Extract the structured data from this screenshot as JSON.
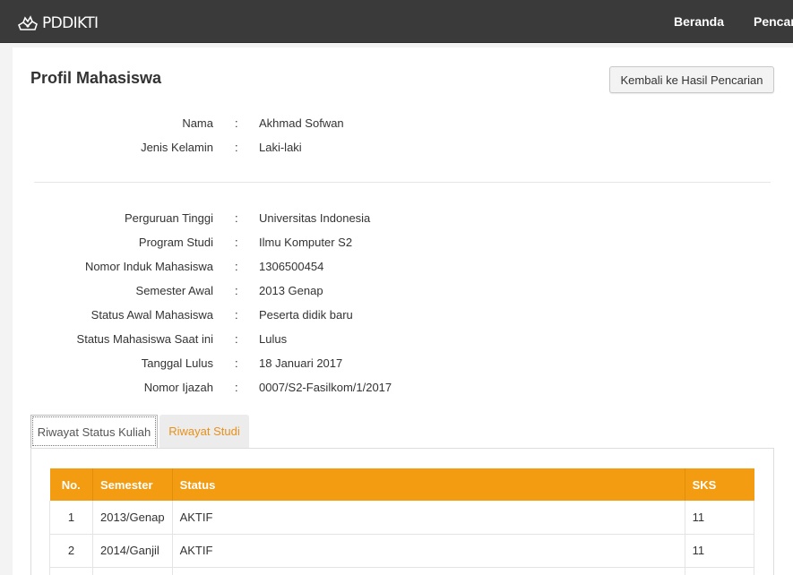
{
  "navbar": {
    "brand": "PDDIKTI",
    "items": [
      "Beranda",
      "Pencarian"
    ]
  },
  "header": {
    "title": "Profil Mahasiswa",
    "back_button": "Kembali ke Hasil Pencarian"
  },
  "profile_basic": [
    {
      "label": "Nama",
      "value": "Akhmad Sofwan"
    },
    {
      "label": "Jenis Kelamin",
      "value": "Laki-laki"
    }
  ],
  "profile_academic": [
    {
      "label": "Perguruan Tinggi",
      "value": "Universitas Indonesia"
    },
    {
      "label": "Program Studi",
      "value": "Ilmu Komputer S2"
    },
    {
      "label": "Nomor Induk Mahasiswa",
      "value": "1306500454"
    },
    {
      "label": "Semester Awal",
      "value": "2013 Genap"
    },
    {
      "label": "Status Awal Mahasiswa",
      "value": "Peserta didik baru"
    },
    {
      "label": "Status Mahasiswa Saat ini",
      "value": "Lulus"
    },
    {
      "label": "Tanggal Lulus",
      "value": "18 Januari 2017"
    },
    {
      "label": "Nomor Ijazah",
      "value": "0007/S2-Fasilkom/1/2017"
    }
  ],
  "separator": ":",
  "tabs": [
    {
      "label": "Riwayat Status Kuliah",
      "active": true
    },
    {
      "label": "Riwayat Studi",
      "active": false
    }
  ],
  "history_table": {
    "headers": [
      "No.",
      "Semester",
      "Status",
      "SKS"
    ],
    "rows": [
      [
        "1",
        "2013/Genap",
        "AKTIF",
        "11"
      ],
      [
        "2",
        "2014/Ganjil",
        "AKTIF",
        "11"
      ],
      [
        "",
        "",
        "",
        ""
      ]
    ]
  },
  "colors": {
    "navbar_bg": "#3a3a3a",
    "table_header_bg": "#f39c12",
    "inactive_tab_text": "#e8901a"
  }
}
